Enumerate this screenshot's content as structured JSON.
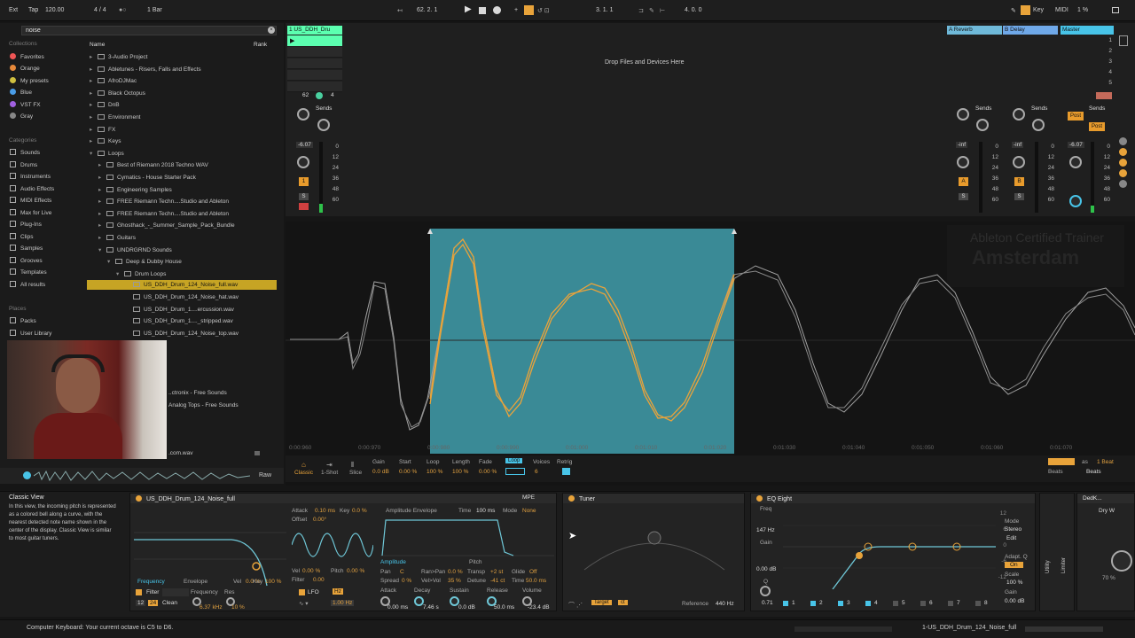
{
  "colors": {
    "accent": "#e8a33a",
    "selection": "#c6a424",
    "clip": "#5cffb0",
    "return_a": "#6fb9d9",
    "return_b": "#6fa8e8",
    "master": "#48c4e8",
    "waveform_sel": "#3a8a96"
  },
  "topbar": {
    "ext": "Ext",
    "tap": "Tap",
    "tempo": "120.00",
    "timesig": "4 / 4",
    "quant": "1 Bar",
    "position": "62.  2.  1",
    "loop_start": "3.  1.  1",
    "loop_len": "4.  0.  0",
    "key": "Key",
    "midi": "MIDI",
    "cpu": "1 %"
  },
  "browser": {
    "search_value": "noise",
    "collections_label": "Collections",
    "collections": [
      "Favorites",
      "Orange",
      "My presets",
      "Blue",
      "VST FX",
      "Gray"
    ],
    "categories_label": "Categories",
    "categories": [
      "Sounds",
      "Drums",
      "Instruments",
      "Audio Effects",
      "MIDI Effects",
      "Max for Live",
      "Plug-Ins",
      "Clips",
      "Samples",
      "Grooves",
      "Templates",
      "All results"
    ],
    "places_label": "Places",
    "places": [
      "Packs",
      "User Library"
    ],
    "col_name": "Name",
    "col_rank": "Rank",
    "items": [
      {
        "label": "3-Audio Project",
        "depth": 0,
        "open": false
      },
      {
        "label": "Abletunes - Risers, Falls and Effects",
        "depth": 0,
        "open": false
      },
      {
        "label": "AfroDJMac",
        "depth": 0,
        "open": false
      },
      {
        "label": "Black Octopus",
        "depth": 0,
        "open": false
      },
      {
        "label": "DnB",
        "depth": 0,
        "open": false
      },
      {
        "label": "Environment",
        "depth": 0,
        "open": false
      },
      {
        "label": "FX",
        "depth": 0,
        "open": false
      },
      {
        "label": "Keys",
        "depth": 0,
        "open": false
      },
      {
        "label": "Loops",
        "depth": 0,
        "open": true
      },
      {
        "label": "Best of Riemann 2018 Techno WAV",
        "depth": 1,
        "open": false
      },
      {
        "label": "Cymatics - House Starter Pack",
        "depth": 1,
        "open": false
      },
      {
        "label": "Engineering Samples",
        "depth": 1,
        "open": false
      },
      {
        "label": "FREE Riemann Techn....Studio and Ableton",
        "depth": 1,
        "open": false
      },
      {
        "label": "FREE Riemann Techn....Studio and Ableton",
        "depth": 1,
        "open": false
      },
      {
        "label": "Ghosthack_-_Summer_Sample_Pack_Bundle",
        "depth": 1,
        "open": false
      },
      {
        "label": "Guitars",
        "depth": 1,
        "open": false
      },
      {
        "label": "UNDRGRND Sounds",
        "depth": 1,
        "open": true
      },
      {
        "label": "Deep & Dubby House",
        "depth": 2,
        "open": true
      },
      {
        "label": "Drum Loops",
        "depth": 3,
        "open": true
      },
      {
        "label": "US_DDH_Drum_124_Noise_full.wav",
        "depth": 4,
        "open": false
      },
      {
        "label": "US_DDH_Drum_124_Noise_hat.wav",
        "depth": 4,
        "open": false
      },
      {
        "label": "US_DDH_Drum_1....ercussion.wav",
        "depth": 4,
        "open": false
      },
      {
        "label": "US_DDH_Drum_1...._stripped.wav",
        "depth": 4,
        "open": false
      },
      {
        "label": "US_DDH_Drum_124_Noise_top.wav",
        "depth": 4,
        "open": false
      }
    ],
    "extra_items": [
      "..ctronix - Free Sounds",
      "Analog Tops - Free Sounds",
      ".com.wav"
    ],
    "raw": "Raw"
  },
  "session": {
    "track_name": "1 US_DDH_Dru",
    "drop_text": "Drop Files and Devices Here",
    "return_a": "A Reverb",
    "return_b": "B Delay",
    "master": "Master",
    "sends": "Sends",
    "track_vol": "-6.07",
    "ret_a_vol": "-inf",
    "ret_b_vol": "-inf",
    "master_vol": "-6.07",
    "track_num": "1",
    "a": "A",
    "b": "B",
    "s": "S",
    "post": "Post",
    "scale": [
      "0",
      "12",
      "24",
      "36",
      "48",
      "60"
    ],
    "scenes": [
      "1",
      "2",
      "3",
      "4",
      "5"
    ],
    "clip_pos": "62",
    "clip_num": "4"
  },
  "editor": {
    "ticks": [
      "0:00:960",
      "0:00:970",
      "0:00:980",
      "0:00:990",
      "0:01:000",
      "0:01:010",
      "0:01:020",
      "0:01:030",
      "0:01:040",
      "0:01:050",
      "0:01:060",
      "0:01:070"
    ],
    "watermark_top": "Ableton Certified Trainer",
    "watermark": "Amsterdam"
  },
  "clipbar": {
    "modes": [
      "Classic",
      "1-Shot",
      "Slice"
    ],
    "labels": [
      "Gain",
      "Start",
      "Loop",
      "Length",
      "Fade",
      "Loop",
      "Voices",
      "Retrig"
    ],
    "values": [
      "0.0 dB",
      "0.00 %",
      "100 %",
      "100 %",
      "0.00 %",
      "6"
    ],
    "beats": "Beats",
    "as": "as",
    "one_beat": "1 Beat",
    "end": "Beats"
  },
  "devices": {
    "info_title": "Classic View",
    "info_text": "In this view, the incoming pitch is represented as a colored bell along a curve, with the nearest detected note name shown in the center of the display. Classic View is similar to most guitar tuners.",
    "simpler": {
      "name": "US_DDH_Drum_124_Noise_full",
      "mpe": "MPE",
      "attack": "Attack",
      "attack_val": "0.10 ms",
      "key": "Key",
      "key_val": "0.0 %",
      "offset": "Offset",
      "offset_val": "0.00°",
      "amp_env": "Amplitude Envelope",
      "time": "Time",
      "time_val": "100 ms",
      "mode": "Mode",
      "mode_val": "None",
      "filter": "Filter",
      "lfo": "LFO",
      "hz": "Hz",
      "hz_val": "1.00 Hz",
      "freq": "Frequency",
      "res": "Res",
      "freq_val": "6.37 kHz",
      "res_val": "10 %",
      "clean": "Clean",
      "env": "Envelope",
      "freq2": "Frequency",
      "vel": "Vel",
      "vel_val": "0.0 %",
      "key2": "Key",
      "key2_val": "100 %",
      "vel2": "Vel",
      "vel2_val": "0.00 %",
      "pitch": "Pitch",
      "pitch_val": "0.00 %",
      "filter_lbl": "Filter",
      "filter_val": "0.00",
      "amplitude": "Amplitude",
      "pitch_tab": "Pitch",
      "pan": "Pan",
      "pan_val": "C",
      "ranpan": "Ran>Pan",
      "ranpan_val": "0.0 %",
      "transp": "Transp",
      "transp_val": "+2 st",
      "glide": "Glide",
      "glide_val": "Off",
      "spread": "Spread",
      "spread_val": "0 %",
      "velvol": "Vel>Vol",
      "velvol_val": "35 %",
      "detune": "Detune",
      "detune_val": "-41 ct",
      "time2": "Time",
      "time2_val": "50.0 ms",
      "attack2": "Attack",
      "attack2_val": "0.00 ms",
      "decay": "Decay",
      "decay_val": "7.46 s",
      "sustain": "Sustain",
      "sustain_val": "0.0 dB",
      "release": "Release",
      "release_val": "50.0 ms",
      "volume": "Volume",
      "volume_val": "-23.4 dB",
      "n12": "12",
      "n24": "24"
    },
    "tuner": {
      "name": "Tuner",
      "target": "Target",
      "ct": "ct",
      "reference": "Reference",
      "reference_val": "440 Hz"
    },
    "eq": {
      "name": "EQ Eight",
      "freq": "Freq",
      "freq_val": "147 Hz",
      "gain": "Gain",
      "gain_val": "0.00 dB",
      "q": "Q",
      "q_val": "0.71",
      "mode": "Mode",
      "mode_val": "Stereo",
      "edit": "Edit",
      "adapt": "Adapt. Q",
      "adapt_val": "On",
      "scale": "Scale",
      "scale_val": "100 %",
      "gain2": "Gain",
      "gain2_val": "0.00 dB",
      "bands": [
        "1",
        "2",
        "3",
        "4",
        "5",
        "6",
        "7",
        "8"
      ],
      "axis": [
        "12",
        "6",
        "0",
        "-6",
        "-12"
      ]
    },
    "utility": "Utility",
    "limiter": "Limiter",
    "dedk": {
      "name": "DedK...",
      "drywet": "Dry W",
      "pct": "70 %"
    }
  },
  "status": {
    "message": "Computer Keyboard: Your current octave is C5 to D6.",
    "clip": "1-US_DDH_Drum_124_Noise_full"
  }
}
